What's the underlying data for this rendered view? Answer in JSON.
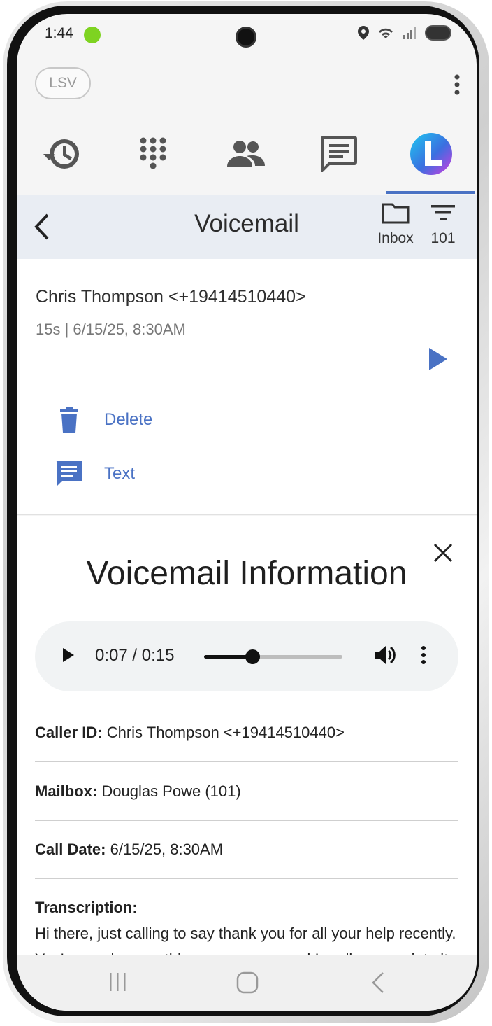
{
  "status_bar": {
    "time": "1:44"
  },
  "top_bar": {
    "account_badge": "LSV"
  },
  "nav_tabs": [
    {
      "name": "history-icon"
    },
    {
      "name": "dialpad-icon"
    },
    {
      "name": "contacts-icon"
    },
    {
      "name": "messages-icon"
    },
    {
      "name": "brand-logo"
    }
  ],
  "voicemail_header": {
    "title": "Voicemail",
    "folder_label": "Inbox",
    "filter_label": "101"
  },
  "voicemail_item": {
    "caller": "Chris Thompson <+19414510440>",
    "meta": "15s | 6/15/25, 8:30AM",
    "actions": [
      {
        "label": "Delete",
        "icon": "trash-icon"
      },
      {
        "label": "Text",
        "icon": "message-icon"
      }
    ]
  },
  "info_panel": {
    "title": "Voicemail Information",
    "player": {
      "time": "0:07 / 0:15",
      "progress": 0.35
    },
    "fields": {
      "caller_id_label": "Caller ID:",
      "caller_id_value": " Chris Thompson <+19414510440>",
      "mailbox_label": "Mailbox:",
      "mailbox_value": " Douglas Powe (101)",
      "call_date_label": "Call Date:",
      "call_date_value": " 6/15/25, 8:30AM",
      "transcription_label": "Transcription:",
      "transcription_value": "Hi there, just calling to say thank you for all your help recently. You've made everything super easy, and I really appreciate it."
    }
  },
  "colors": {
    "accent": "#4a72c4",
    "header_bg": "#e9edf3",
    "status_dot": "#7ed321"
  }
}
